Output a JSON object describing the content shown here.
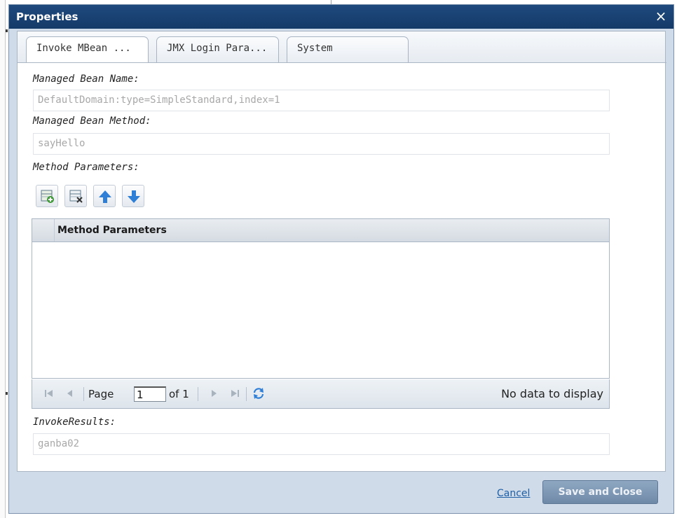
{
  "dialog": {
    "title": "Properties",
    "close_glyph": "×"
  },
  "tabs": [
    {
      "label": "Invoke MBean ...",
      "active": true
    },
    {
      "label": "JMX Login Para...",
      "active": false
    },
    {
      "label": "System",
      "active": false
    }
  ],
  "form": {
    "bean_name_label": "Managed Bean Name:",
    "bean_name_value": "DefaultDomain:type=SimpleStandard,index=1",
    "bean_method_label": "Managed Bean Method:",
    "bean_method_value": "sayHello",
    "params_label": "Method Parameters:",
    "results_label": "InvokeResults:",
    "results_value": "ganba02"
  },
  "toolbar": {
    "icons": [
      "add-row-icon",
      "delete-row-icon",
      "move-up-icon",
      "move-down-icon"
    ]
  },
  "grid": {
    "column_header": "Method Parameters"
  },
  "pager": {
    "page_label": "Page",
    "page_value": "1",
    "of_label": "of 1",
    "info": "No data to display"
  },
  "footer": {
    "cancel_label": "Cancel",
    "save_label": "Save and Close"
  },
  "colors": {
    "titlebar": "#143a68",
    "accent_blue": "#2f7fd6",
    "save_button": "#7b93b1"
  }
}
